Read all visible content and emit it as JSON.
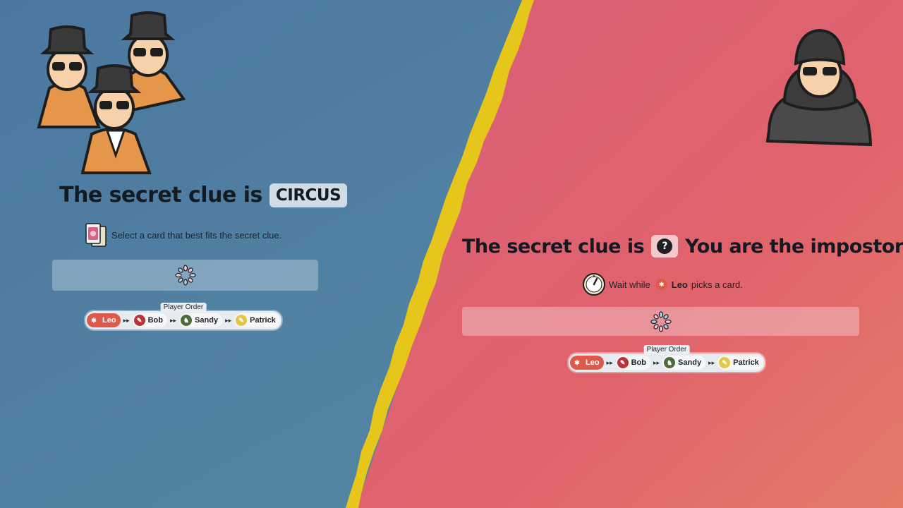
{
  "colors": {
    "left_bg": "#4f7fa0",
    "right_bg": "#e0646e",
    "divider": "#e7c61b",
    "active_player": "#dd5a4a"
  },
  "left_panel": {
    "headline_prefix": "The secret clue is",
    "clue_word": "CIRCUS",
    "instruction": "Select a card that best fits the secret clue.",
    "instruction_icon": "card-icon",
    "loader_icon": "spinner-icon",
    "order_label": "Player Order",
    "players": [
      {
        "name": "Leo",
        "color": "#dd5a4a",
        "active": true
      },
      {
        "name": "Bob",
        "color": "#b8333a",
        "active": false
      },
      {
        "name": "Sandy",
        "color": "#4e6b3a",
        "active": false
      },
      {
        "name": "Patrick",
        "color": "#e3c64a",
        "active": false
      }
    ]
  },
  "right_panel": {
    "headline_prefix": "The secret clue is",
    "clue_hidden_icon": "question-icon",
    "clue_hidden_glyph": "?",
    "headline_suffix": "You are the impostor!",
    "wait_prefix": "Wait while",
    "wait_player": "Leo",
    "wait_suffix": "picks a card.",
    "timer_icon": "timer-icon",
    "loader_icon": "spinner-icon",
    "order_label": "Player Order",
    "players": [
      {
        "name": "Leo",
        "color": "#dd5a4a",
        "active": true
      },
      {
        "name": "Bob",
        "color": "#b8333a",
        "active": false
      },
      {
        "name": "Sandy",
        "color": "#4e6b3a",
        "active": false
      },
      {
        "name": "Patrick",
        "color": "#e3c64a",
        "active": false
      }
    ]
  }
}
